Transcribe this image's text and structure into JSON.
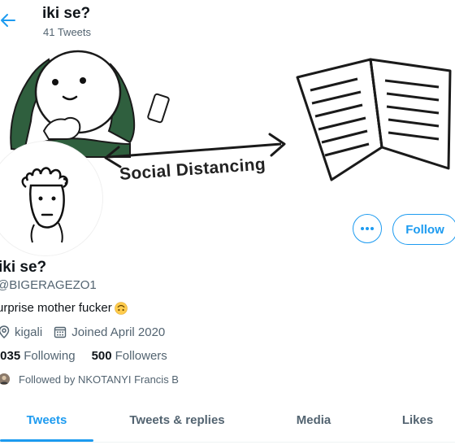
{
  "header": {
    "title": "iki se?",
    "tweet_count": "41 Tweets"
  },
  "banner": {
    "caption": "Social Distancing"
  },
  "actions": {
    "more_label": "•••",
    "follow_label": "Follow"
  },
  "profile": {
    "name": "iki se?",
    "handle": "@BIGERAGEZO1",
    "bio": "urprise mother fucker",
    "bio_emoji": "upside-down-face-emoji",
    "location": "kigali",
    "joined": "Joined April 2020",
    "following_count": ",035",
    "following_label": "Following",
    "followers_count": "500",
    "followers_label": "Followers",
    "followed_by": "Followed by NKOTANYI Francis B"
  },
  "tabs": [
    {
      "label": "Tweets",
      "active": true
    },
    {
      "label": "Tweets & replies",
      "active": false
    },
    {
      "label": "Media",
      "active": false
    },
    {
      "label": "Likes",
      "active": false
    }
  ],
  "colors": {
    "accent": "#1d9bf0",
    "text": "#0f1419",
    "muted": "#536471",
    "meme_green": "#2f5f3e"
  },
  "icons": {
    "back": "back-arrow-icon",
    "more": "more-horizontal-icon",
    "location": "location-pin-icon",
    "calendar": "calendar-icon"
  }
}
